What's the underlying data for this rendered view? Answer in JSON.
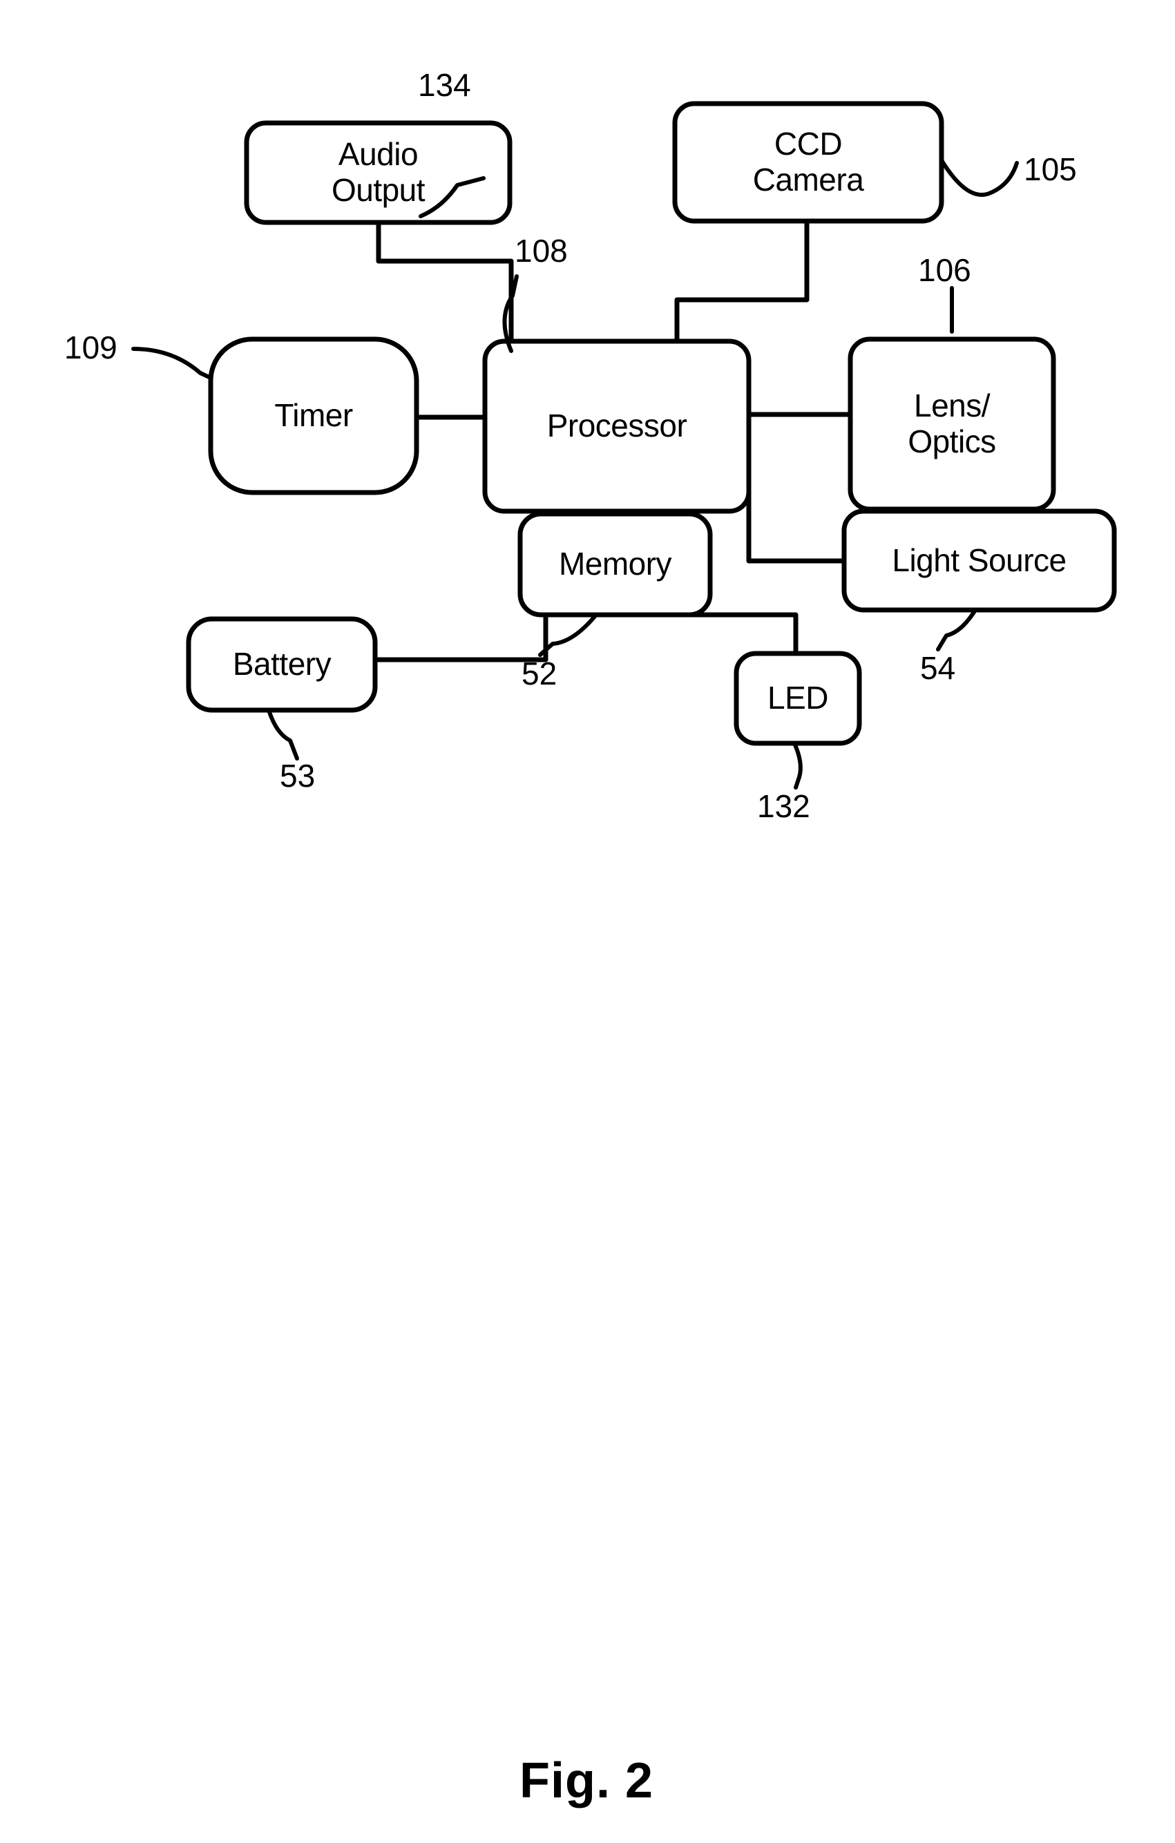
{
  "figure": {
    "caption": "Fig. 2",
    "type": "patent-block-diagram",
    "background_color": "#ffffff",
    "line_color": "#000000"
  },
  "blocks": [
    {
      "id": "audio-output",
      "label": "Audio\nOutput",
      "ref": "134"
    },
    {
      "id": "ccd-camera",
      "label": "CCD\nCamera",
      "ref": "105"
    },
    {
      "id": "timer",
      "label": "Timer",
      "ref": "109"
    },
    {
      "id": "processor",
      "label": "Processor",
      "ref": "108"
    },
    {
      "id": "lens-optics",
      "label": "Lens/\nOptics",
      "ref": "106"
    },
    {
      "id": "memory",
      "label": "Memory",
      "ref": "52"
    },
    {
      "id": "battery",
      "label": "Battery",
      "ref": "53"
    },
    {
      "id": "led",
      "label": "LED",
      "ref": "132"
    },
    {
      "id": "light-source",
      "label": "Light Source",
      "ref": "54"
    }
  ],
  "labels": {
    "audio_output": "Audio\nOutput",
    "ccd_camera": "CCD\nCamera",
    "timer": "Timer",
    "processor": "Processor",
    "lens_optics": "Lens/\nOptics",
    "memory": "Memory",
    "battery": "Battery",
    "led": "LED",
    "light_source": "Light Source"
  },
  "refs": {
    "audio_output": "134",
    "ccd_camera": "105",
    "lens_optics": "106",
    "processor": "108",
    "timer": "109",
    "memory": "52",
    "battery": "53",
    "led": "132",
    "light_source": "54"
  },
  "connections": [
    {
      "from": "audio-output",
      "to": "processor"
    },
    {
      "from": "ccd-camera",
      "to": "processor"
    },
    {
      "from": "timer",
      "to": "processor"
    },
    {
      "from": "processor",
      "to": "lens-optics"
    },
    {
      "from": "processor",
      "to": "memory"
    },
    {
      "from": "processor",
      "to": "battery"
    },
    {
      "from": "processor",
      "to": "led"
    },
    {
      "from": "processor",
      "to": "light-source"
    }
  ]
}
